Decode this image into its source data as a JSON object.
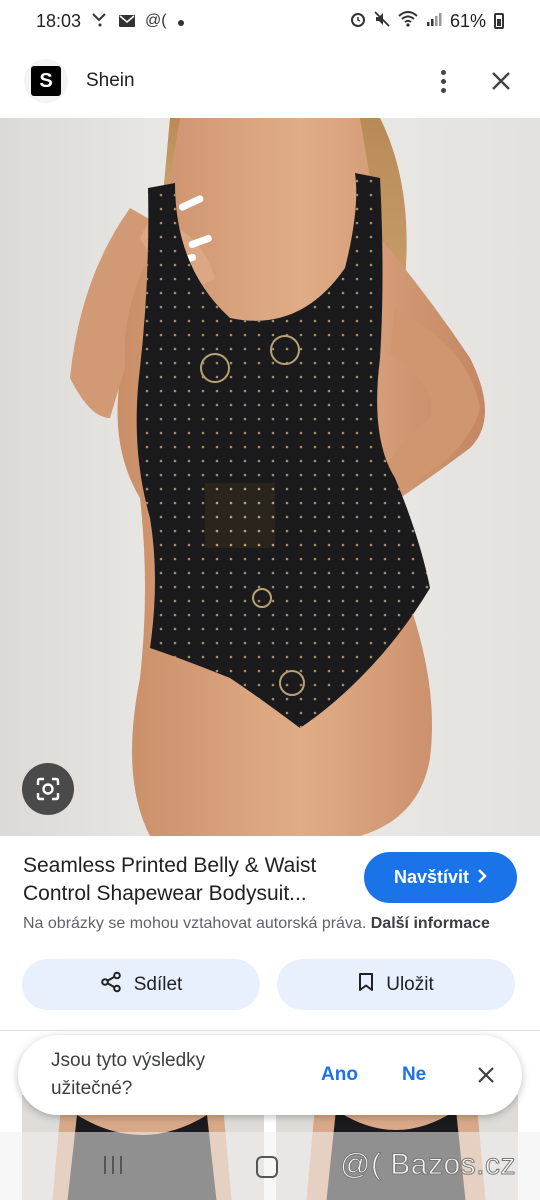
{
  "status_bar": {
    "time": "18:03",
    "battery": "61%",
    "icons": [
      "missed-call-icon",
      "mail-icon",
      "at-icon",
      "dot-icon",
      "alarm-icon",
      "mute-icon",
      "wifi-icon",
      "signal-icon",
      "battery-icon"
    ]
  },
  "header": {
    "logo_letter": "S",
    "site_name": "Shein",
    "menu_icon": "more-vert-icon",
    "close_icon": "close-icon"
  },
  "hero": {
    "lens_icon": "google-lens-icon"
  },
  "result": {
    "title_line1": "Seamless Printed Belly & Waist",
    "title_line2": "Control Shapewear Bodysuit...",
    "visit_label": "Navštívit",
    "copyright_text": "Na obrázky se mohou vztahovat autorská práva.",
    "more_info": "Další informace"
  },
  "actions": {
    "share_label": "Sdílet",
    "save_label": "Uložit"
  },
  "feedback": {
    "question_line1": "Jsou tyto výsledky",
    "question_line2": "užitečné?",
    "yes": "Ano",
    "no": "Ne"
  },
  "watermark": "@( Bazos.cz",
  "colors": {
    "accent": "#1a73e8",
    "action_bg": "#e8f0fe",
    "garment": "#1b1b1d",
    "print": "#b8a274"
  }
}
